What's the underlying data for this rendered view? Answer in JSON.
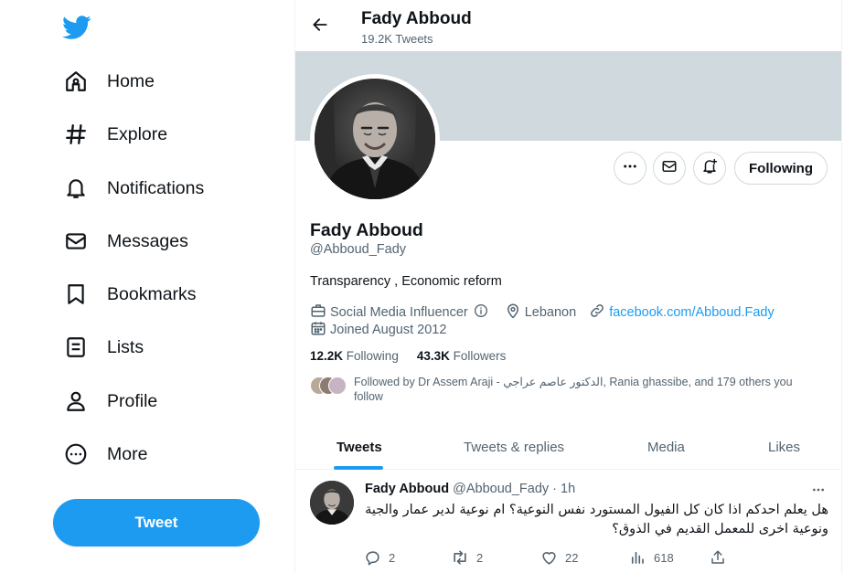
{
  "sidebar": {
    "logo": "twitter-bird-icon",
    "items": [
      {
        "label": "Home",
        "icon": "home-icon"
      },
      {
        "label": "Explore",
        "icon": "hashtag-icon"
      },
      {
        "label": "Notifications",
        "icon": "bell-icon"
      },
      {
        "label": "Messages",
        "icon": "envelope-icon"
      },
      {
        "label": "Bookmarks",
        "icon": "bookmark-icon"
      },
      {
        "label": "Lists",
        "icon": "list-icon"
      },
      {
        "label": "Profile",
        "icon": "person-icon"
      },
      {
        "label": "More",
        "icon": "more-circle-icon"
      }
    ],
    "tweet_button": "Tweet"
  },
  "header": {
    "name": "Fady Abboud",
    "tweet_count": "19.2K Tweets"
  },
  "profile": {
    "name": "Fady Abboud",
    "handle": "@Abboud_Fady",
    "bio": "Transparency , Economic reform",
    "category": "Social Media Influencer",
    "location": "Lebanon",
    "website": "facebook.com/Abboud.Fady",
    "joined": "Joined August 2012",
    "following_count": "12.2K",
    "following_label": "Following",
    "followers_count": "43.3K",
    "followers_label": "Followers",
    "followed_by": "Followed by Dr Assem Araji - الدكتور عاصم عراجي, Rania ghassibe, and 179 others you follow",
    "following_button": "Following"
  },
  "tabs": [
    "Tweets",
    "Tweets & replies",
    "Media",
    "Likes"
  ],
  "active_tab": "Tweets",
  "tweet": {
    "name": "Fady Abboud",
    "meta": "@Abboud_Fady · 1h",
    "text": "هل يعلم احدكم اذا كان كل الفيول المستورد نفس النوعية؟ ام نوعية لدير عمار والجية ونوعية اخرى للمعمل القديم في الذوق؟",
    "replies": "2",
    "retweets": "2",
    "likes": "22",
    "views": "618"
  },
  "colors": {
    "accent": "#1d9bf0",
    "banner": "#cfd9de",
    "text_secondary": "#536471"
  }
}
